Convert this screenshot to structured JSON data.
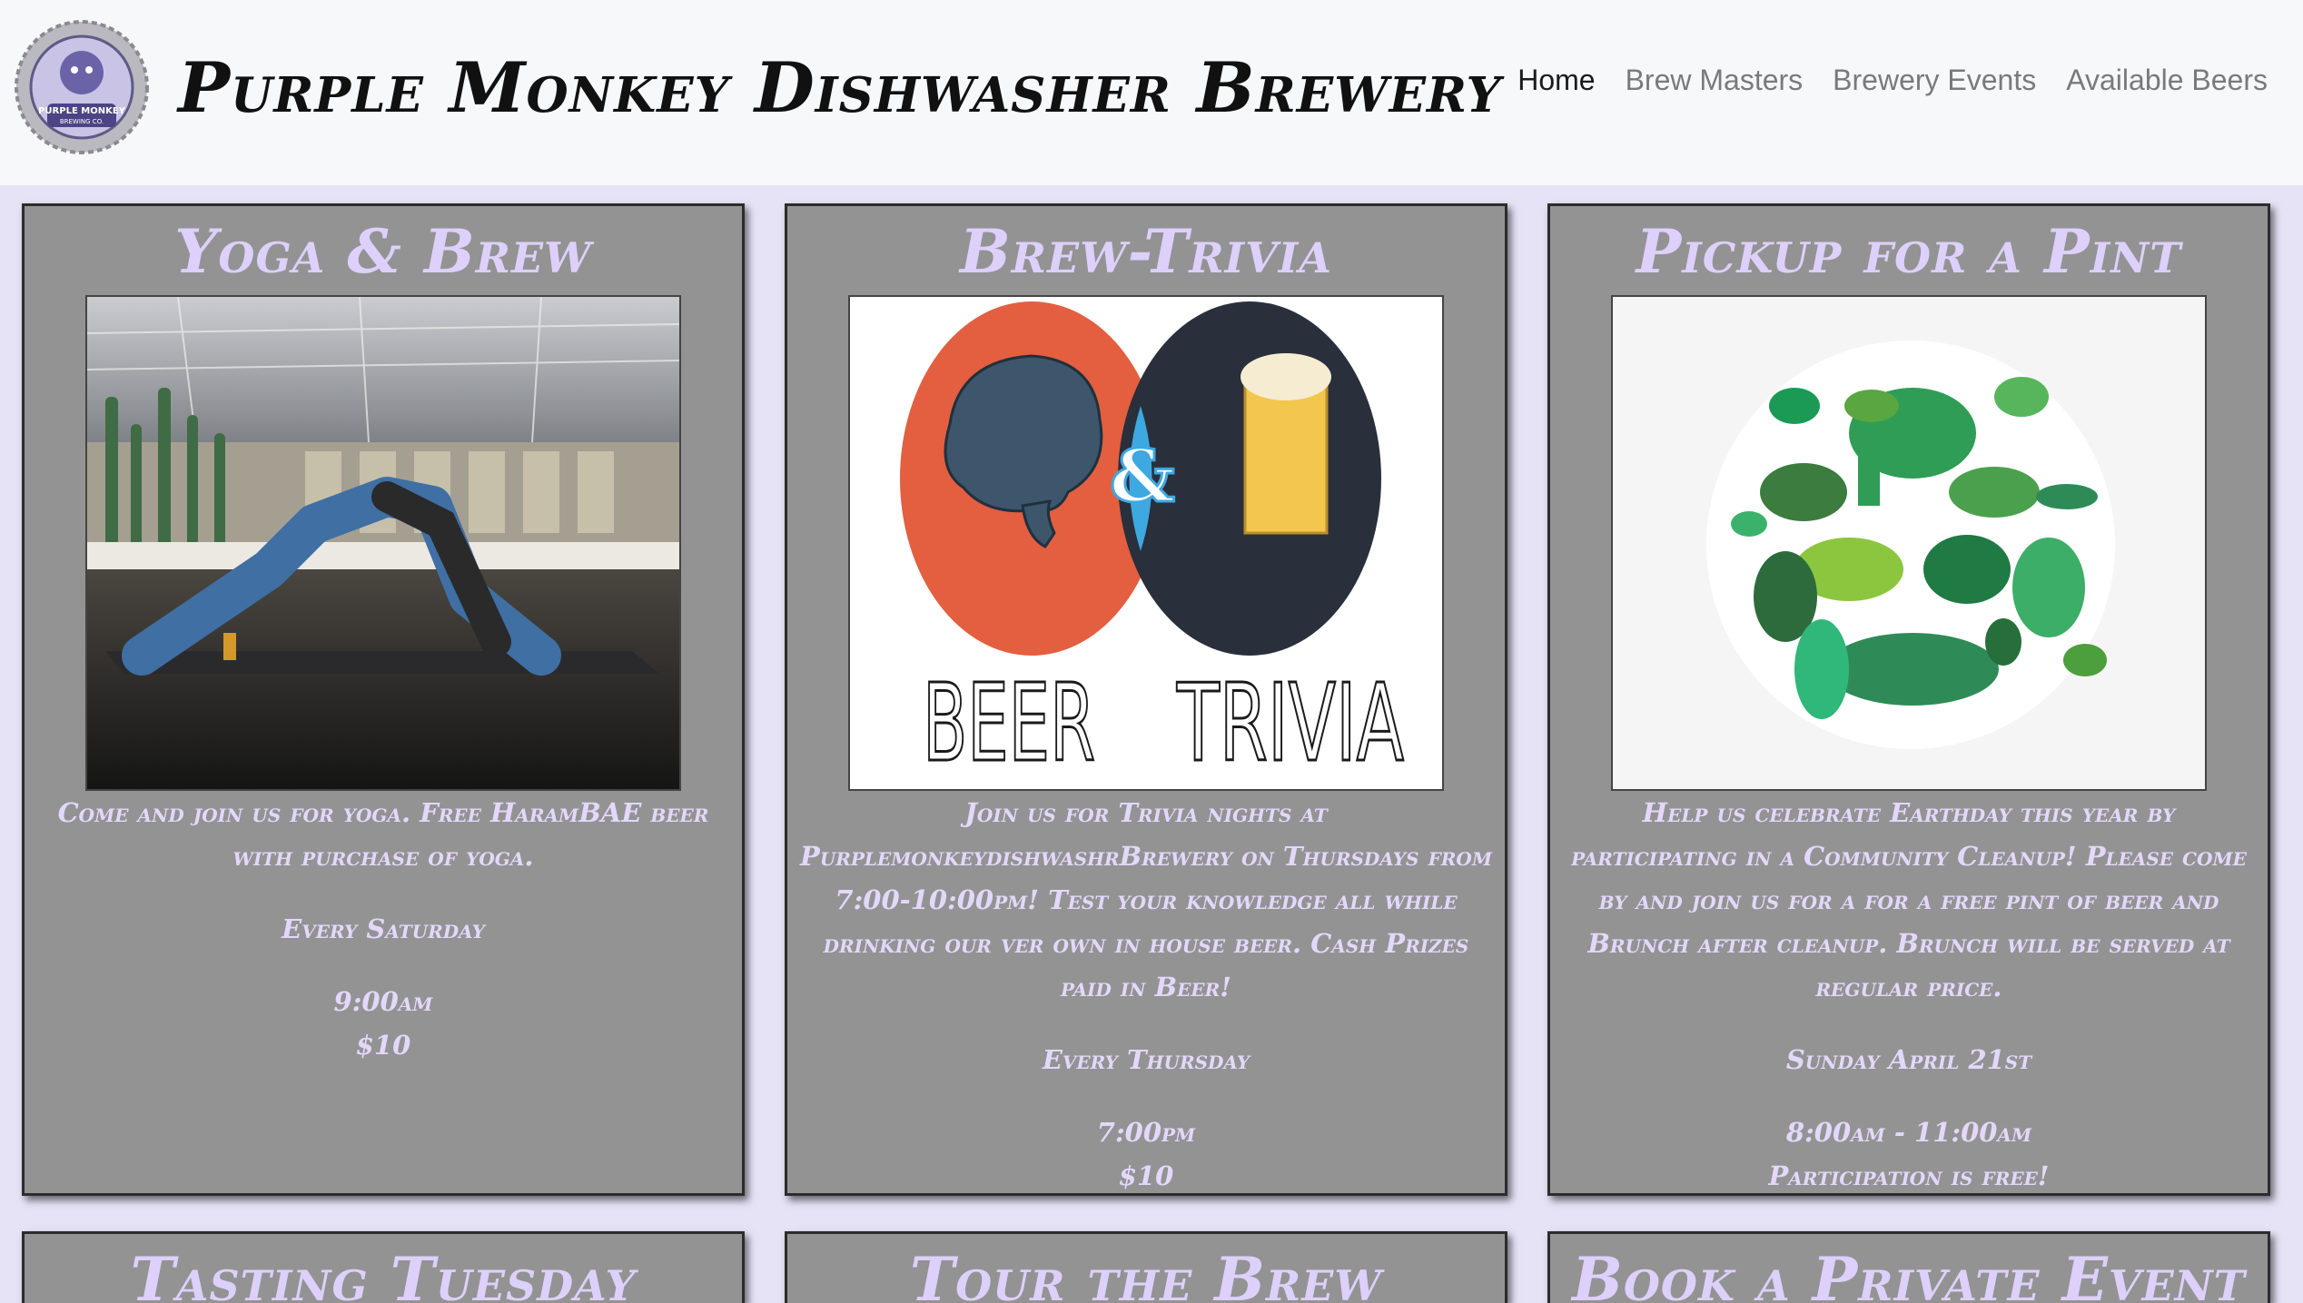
{
  "brand": {
    "title": "Purple Monkey Dishwasher Brewery",
    "logo_text": "PURPLE MONKEY",
    "logo_subtext": "BREWING CO."
  },
  "nav": {
    "home": "Home",
    "brew_masters": "Brew Masters",
    "events": "Brewery Events",
    "beers": "Available Beers"
  },
  "cards": [
    {
      "title": "Yoga & Brew",
      "description": "Come and join us for yoga. Free HaramBAE beer with purchase of yoga.",
      "schedule": "Every Saturday",
      "time": "9:00am",
      "price": "$10"
    },
    {
      "title": "Brew-Trivia",
      "image_left_text": "BEER",
      "image_right_text": "TRIVIA",
      "image_amp": "&",
      "description": "Join us for Trivia nights at PurplemonkeydishwashrBrewery on Thursdays from 7:00-10:00pm! Test your knowledge all while drinking our ver own in house beer. Cash Prizes paid in Beer!",
      "schedule": "Every Thursday",
      "time": "7:00pm",
      "price": "$10"
    },
    {
      "title": "Pickup for a Pint",
      "description": "Help us celebrate Earthday this year by participating in a Community Cleanup! Please come by and join us for a for a free pint of beer and Brunch after cleanup. Brunch will be served at regular price.",
      "schedule": "Sunday April 21st",
      "time": "8:00am - 11:00am",
      "price": "Participation is free!"
    },
    {
      "title": "Tasting Tuesday"
    },
    {
      "title": "Tour the Brew"
    },
    {
      "title": "Book a Private Event"
    }
  ]
}
